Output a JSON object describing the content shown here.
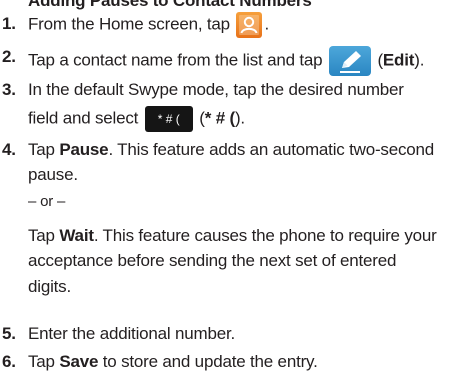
{
  "heading": "Adding Pauses to Contact Numbers",
  "icons": {
    "contacts": "contacts-icon",
    "edit": "pencil-edit-icon"
  },
  "colors": {
    "contacts_icon": "#ef8a2b",
    "edit_icon": "#3a98d1",
    "symbol_key": "#151515"
  },
  "steps": [
    {
      "number": "1.",
      "before": "From the Home screen, tap",
      "after": "."
    },
    {
      "number": "2.",
      "before": "Tap a contact name from the list and tap",
      "bold": "Edit",
      "open": "(",
      "close": ")."
    },
    {
      "number": "3.",
      "line1": "In the default Swype mode, tap the desired number",
      "line2_before": "field and select",
      "key_label": "* # (",
      "open": "(",
      "bold": "* # (",
      "close": ")."
    },
    {
      "number": "4.",
      "line1_before": "Tap",
      "line1_bold": "Pause",
      "line1_after": ". This feature adds an automatic two-second",
      "line2": "pause.",
      "or": "– or –",
      "alt_before": "Tap",
      "alt_bold": "Wait",
      "alt_line1_after": ". This feature causes the phone to require your",
      "alt_line2": "acceptance before sending the next set of entered",
      "alt_line3": "digits."
    },
    {
      "number": "5.",
      "text": "Enter the additional number."
    },
    {
      "number": "6.",
      "before": "Tap",
      "bold": "Save",
      "after": "to store and update the entry."
    }
  ]
}
